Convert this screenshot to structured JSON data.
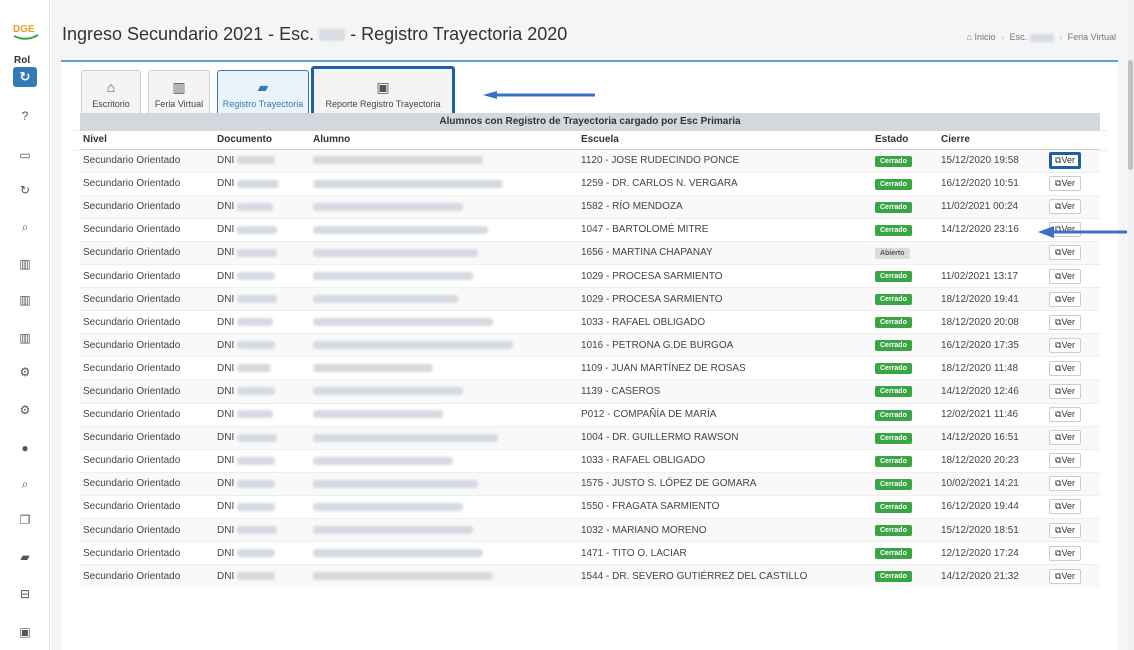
{
  "sidebar": {
    "rol_label": "Rol",
    "icons": [
      {
        "name": "help-icon",
        "glyph": "?"
      },
      {
        "name": "desktop-icon",
        "glyph": "▭"
      },
      {
        "name": "refresh-icon",
        "glyph": "↻"
      },
      {
        "name": "search-icon",
        "glyph": "⌕"
      },
      {
        "name": "building-icon",
        "glyph": "▥"
      },
      {
        "name": "building-icon",
        "glyph": "▥"
      },
      {
        "name": "building-icon",
        "glyph": "▥"
      },
      {
        "name": "cogs-icon",
        "glyph": "⚙"
      },
      {
        "name": "cogs-icon",
        "glyph": "⚙"
      },
      {
        "name": "user-icon",
        "glyph": "●"
      },
      {
        "name": "search-icon",
        "glyph": "⌕"
      },
      {
        "name": "copy-icon",
        "glyph": "❐"
      },
      {
        "name": "book-icon",
        "glyph": "▰"
      },
      {
        "name": "bus-icon",
        "glyph": "⊟"
      },
      {
        "name": "excel-icon",
        "glyph": "▣"
      }
    ]
  },
  "header": {
    "title_prefix": "Ingreso Secundario 2021 - Esc. ",
    "title_suffix": " - Registro Trayectoria 2020",
    "breadcrumb_home": "Inicio",
    "breadcrumb_esc": "Esc.",
    "breadcrumb_last": "Feria Virtual"
  },
  "tiles": {
    "escritorio": "Escritorio",
    "feria": "Feria Virtual",
    "registro": "Registro Trayectoria",
    "reporte": "Reporte Registro Trayectoria"
  },
  "table": {
    "caption": "Alumnos con Registro de Trayectoria cargado por Esc Primaria",
    "headers": [
      "Nivel",
      "Documento",
      "Alumno",
      "Escuela",
      "Estado",
      "Cierre",
      ""
    ],
    "ver_label": "Ver",
    "rows": [
      {
        "nivel": "Secundario Orientado",
        "doc": "DNI",
        "escuela": "1120 - JOSE RUDECINDO PONCE",
        "estado": "Cerrado",
        "cierre": "15/12/2020 19:58"
      },
      {
        "nivel": "Secundario Orientado",
        "doc": "DNI",
        "escuela": "1259 - DR. CARLOS N. VERGARA",
        "estado": "Cerrado",
        "cierre": "16/12/2020 10:51"
      },
      {
        "nivel": "Secundario Orientado",
        "doc": "DNI",
        "escuela": "1582 - RÍO MENDOZA",
        "estado": "Cerrado",
        "cierre": "11/02/2021 00:24"
      },
      {
        "nivel": "Secundario Orientado",
        "doc": "DNI",
        "escuela": "1047 - BARTOLOMÉ MITRE",
        "estado": "Cerrado",
        "cierre": "14/12/2020 23:16"
      },
      {
        "nivel": "Secundario Orientado",
        "doc": "DNI",
        "escuela": "1656 - MARTINA CHAPANAY",
        "estado": "Abierto",
        "cierre": ""
      },
      {
        "nivel": "Secundario Orientado",
        "doc": "DNI",
        "escuela": "1029 - PROCESA SARMIENTO",
        "estado": "Cerrado",
        "cierre": "11/02/2021 13:17"
      },
      {
        "nivel": "Secundario Orientado",
        "doc": "DNI",
        "escuela": "1029 - PROCESA SARMIENTO",
        "estado": "Cerrado",
        "cierre": "18/12/2020 19:41"
      },
      {
        "nivel": "Secundario Orientado",
        "doc": "DNI",
        "escuela": "1033 - RAFAEL OBLIGADO",
        "estado": "Cerrado",
        "cierre": "18/12/2020 20:08"
      },
      {
        "nivel": "Secundario Orientado",
        "doc": "DNI",
        "escuela": "1016 - PETRONA G.DE BURGOA",
        "estado": "Cerrado",
        "cierre": "16/12/2020 17:35"
      },
      {
        "nivel": "Secundario Orientado",
        "doc": "DNI",
        "escuela": "1109 - JUAN MARTÍNEZ DE ROSAS",
        "estado": "Cerrado",
        "cierre": "18/12/2020 11:48"
      },
      {
        "nivel": "Secundario Orientado",
        "doc": "DNI",
        "escuela": "1139 - CASEROS",
        "estado": "Cerrado",
        "cierre": "14/12/2020 12:46"
      },
      {
        "nivel": "Secundario Orientado",
        "doc": "DNI",
        "escuela": "P012 - COMPAÑÍA DE MARÍA",
        "estado": "Cerrado",
        "cierre": "12/02/2021 11:46"
      },
      {
        "nivel": "Secundario Orientado",
        "doc": "DNI",
        "escuela": "1004 - DR. GUILLERMO RAWSON",
        "estado": "Cerrado",
        "cierre": "14/12/2020 16:51"
      },
      {
        "nivel": "Secundario Orientado",
        "doc": "DNI",
        "escuela": "1033 - RAFAEL OBLIGADO",
        "estado": "Cerrado",
        "cierre": "18/12/2020 20:23"
      },
      {
        "nivel": "Secundario Orientado",
        "doc": "DNI",
        "escuela": "1575 - JUSTO S. LÓPEZ DE GOMARA",
        "estado": "Cerrado",
        "cierre": "10/02/2021 14:21"
      },
      {
        "nivel": "Secundario Orientado",
        "doc": "DNI",
        "escuela": "1550 - FRAGATA SARMIENTO",
        "estado": "Cerrado",
        "cierre": "16/12/2020 19:44"
      },
      {
        "nivel": "Secundario Orientado",
        "doc": "DNI",
        "escuela": "1032 - MARIANO MORENO",
        "estado": "Cerrado",
        "cierre": "15/12/2020 18:51"
      },
      {
        "nivel": "Secundario Orientado",
        "doc": "DNI",
        "escuela": "1471 - TITO O. LACIAR",
        "estado": "Cerrado",
        "cierre": "12/12/2020 17:24"
      },
      {
        "nivel": "Secundario Orientado",
        "doc": "DNI",
        "escuela": "1544 - DR. SEVERO GUTIÉRREZ DEL CASTILLO",
        "estado": "Cerrado",
        "cierre": "14/12/2020 21:32"
      }
    ]
  },
  "colors": {
    "accent": "#337ab7",
    "success": "#3aa545",
    "highlight": "#1f5fa8"
  }
}
